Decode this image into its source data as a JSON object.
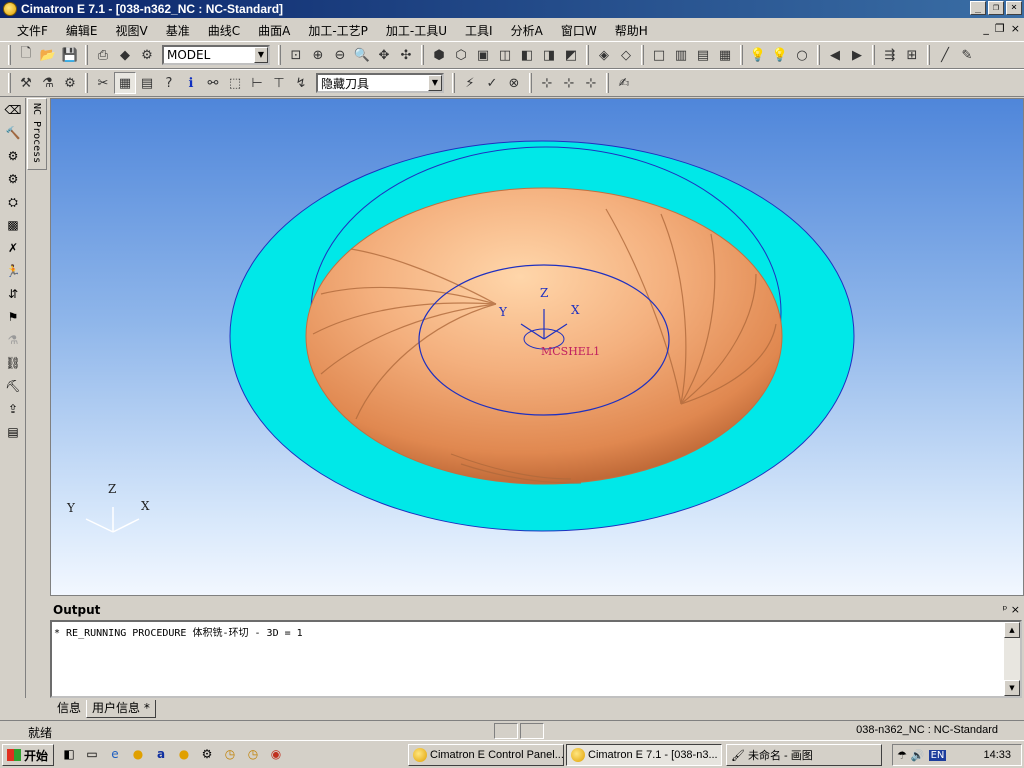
{
  "window": {
    "title": "Cimatron E 7.1 - [038-n362_NC : NC-Standard]"
  },
  "menu": [
    "文件F",
    "编辑E",
    "视图V",
    "基准",
    "曲线C",
    "曲面A",
    "加工-工艺P",
    "加工-工具U",
    "工具I",
    "分析A",
    "窗口W",
    "帮助H"
  ],
  "toolbar1": {
    "model_combo": "MODEL"
  },
  "toolbar2": {
    "tool_combo": "隐藏刀具"
  },
  "left_tab": "NC Process",
  "viewport": {
    "mcs_label": "MCSHEL1",
    "part_axis": {
      "x": "X",
      "y": "Y",
      "z": "Z"
    },
    "triad": {
      "x": "X",
      "y": "Y",
      "z": "Z"
    },
    "colors": {
      "stock": "#00e8e8",
      "part": "#f0a878",
      "curve": "#2020c0"
    }
  },
  "output": {
    "title": "Output",
    "controls": "ᵖ ×",
    "lines": [
      "* RE_RUNNING PROCEDURE 体积铣-环切 - 3D = 1"
    ],
    "tabs": [
      "信息",
      "用户信息 *"
    ]
  },
  "status": {
    "left": "就绪",
    "right": "038-n362_NC : NC-Standard"
  },
  "taskbar": {
    "start": "开始",
    "tasks": [
      "Cimatron E Control Panel...",
      "Cimatron E 7.1 - [038-n3...",
      "未命名 - 画图"
    ],
    "tray_lang": "EN",
    "clock": "14:33"
  }
}
